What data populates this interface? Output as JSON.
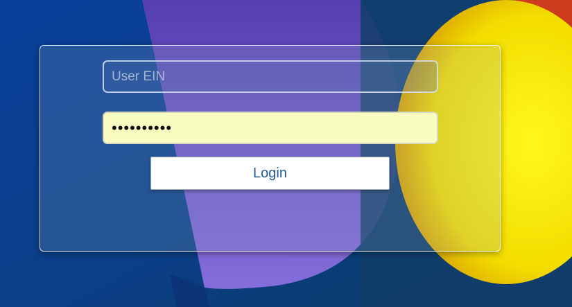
{
  "login_form": {
    "user_placeholder": "User EIN",
    "user_value": "",
    "password_value": "••••••••••",
    "login_label": "Login"
  },
  "colors": {
    "background_blue": "#0b3a8c",
    "purple_shape": "#7d66d6",
    "yellow_circle": "#f2e400",
    "password_fill": "#fafdc2",
    "button_text": "#1f5a96"
  }
}
